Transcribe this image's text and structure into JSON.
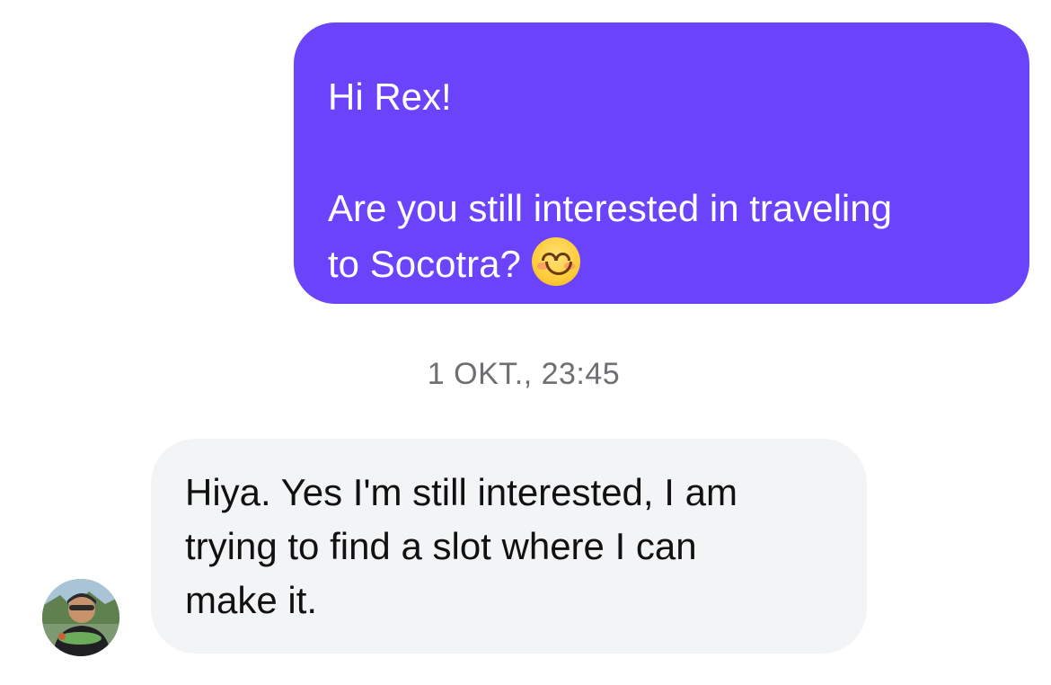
{
  "messages": [
    {
      "direction": "outgoing",
      "line1": "Hi Rex!",
      "line2": "Are you still interested in traveling",
      "line3": "to Socotra?",
      "emoji": "smiling-face-icon",
      "bubble_color": "#6a43fb"
    },
    {
      "direction": "incoming",
      "line1": "Hiya. Yes I'm still interested, I am",
      "line2": "trying to find a slot where I can",
      "line3": "make it.",
      "bubble_color": "#f3f4f6"
    }
  ],
  "timestamp": "1 OKT., 23:45"
}
